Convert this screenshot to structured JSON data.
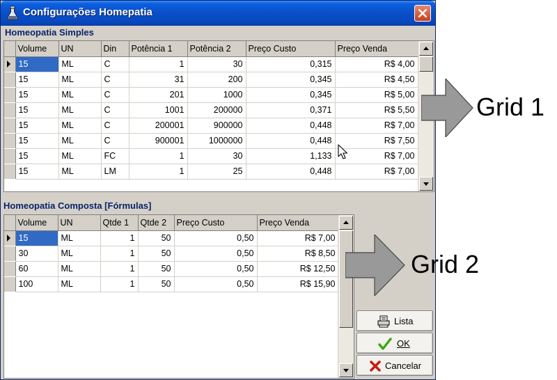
{
  "window": {
    "title": "Configurações Homepatia"
  },
  "grid1": {
    "label": "Homeopatia Simples",
    "columns": [
      "Volume",
      "UN",
      "Din",
      "Potência 1",
      "Potência 2",
      "Preço Custo",
      "Preço Venda"
    ],
    "rows": [
      [
        "15",
        "ML",
        "C",
        "1",
        "30",
        "0,315",
        "R$ 4,00"
      ],
      [
        "15",
        "ML",
        "C",
        "31",
        "200",
        "0,345",
        "R$ 4,50"
      ],
      [
        "15",
        "ML",
        "C",
        "201",
        "1000",
        "0,345",
        "R$ 5,00"
      ],
      [
        "15",
        "ML",
        "C",
        "1001",
        "200000",
        "0,371",
        "R$ 5,50"
      ],
      [
        "15",
        "ML",
        "C",
        "200001",
        "900000",
        "0,448",
        "R$ 7,00"
      ],
      [
        "15",
        "ML",
        "C",
        "900001",
        "1000000",
        "0,448",
        "R$ 7,50"
      ],
      [
        "15",
        "ML",
        "FC",
        "1",
        "30",
        "1,133",
        "R$ 7,00"
      ],
      [
        "15",
        "ML",
        "LM",
        "1",
        "25",
        "0,448",
        "R$ 7,00"
      ]
    ]
  },
  "grid2": {
    "label": "Homeopatia Composta [Fórmulas]",
    "columns": [
      "Volume",
      "UN",
      "Qtde 1",
      "Qtde 2",
      "Preço Custo",
      "Preço Venda"
    ],
    "rows": [
      [
        "15",
        "ML",
        "1",
        "50",
        "0,50",
        "R$ 7,00"
      ],
      [
        "30",
        "ML",
        "1",
        "50",
        "0,50",
        "R$ 8,50"
      ],
      [
        "60",
        "ML",
        "1",
        "50",
        "0,50",
        "R$ 12,50"
      ],
      [
        "100",
        "ML",
        "1",
        "50",
        "0,50",
        "R$ 15,90"
      ]
    ]
  },
  "buttons": {
    "lista": "Lista",
    "ok": "OK",
    "cancelar": "Cancelar"
  },
  "annotations": {
    "grid1": "Grid 1",
    "grid2": "Grid 2"
  },
  "icons": {
    "title": "flask-icon",
    "close": "close-icon",
    "lista": "printer-icon",
    "ok": "checkmark-icon",
    "cancelar": "x-icon",
    "row_indicator": "row-pointer-icon",
    "scroll_up": "scroll-up-icon",
    "scroll_down": "scroll-down-icon",
    "cursor": "mouse-cursor-icon",
    "annotation_arrow": "arrow-right-icon"
  },
  "colors": {
    "title_bar": "#0a4fc7",
    "selection": "#316ac5",
    "label_text": "#0a246a",
    "close_button": "#c93f1e",
    "window_face": "#d4d0c8",
    "annotation_arrow": "#999999"
  }
}
